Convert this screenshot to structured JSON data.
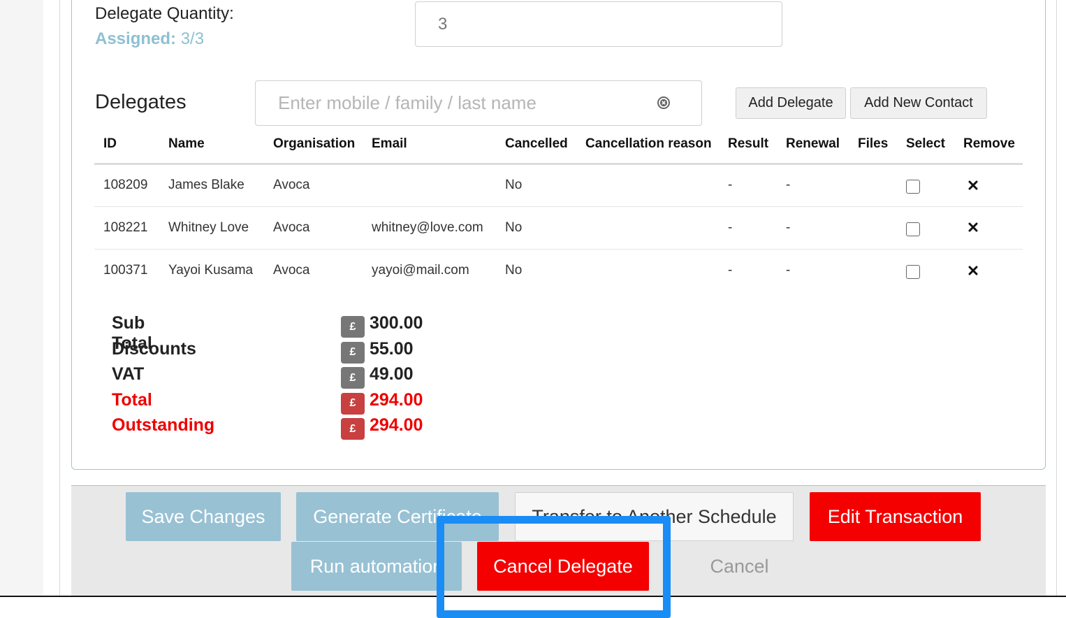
{
  "quantity": {
    "label": "Delegate Quantity:",
    "assigned_label": "Assigned:",
    "assigned_value": "3/3",
    "value": "3"
  },
  "delegates": {
    "title": "Delegates",
    "search_placeholder": "Enter mobile / family / last name",
    "add_delegate_label": "Add Delegate",
    "add_contact_label": "Add New Contact",
    "columns": [
      "ID",
      "Name",
      "Organisation",
      "Email",
      "Cancelled",
      "Cancellation reason",
      "Result",
      "Renewal",
      "Files",
      "Select",
      "Remove"
    ],
    "rows": [
      {
        "id": "108209",
        "name": "James Blake",
        "org": "Avoca",
        "email": "",
        "cancelled": "No",
        "reason": "",
        "result": "-",
        "renewal": "-",
        "files": ""
      },
      {
        "id": "108221",
        "name": "Whitney Love",
        "org": "Avoca",
        "email": "whitney@love.com",
        "cancelled": "No",
        "reason": "",
        "result": "-",
        "renewal": "-",
        "files": ""
      },
      {
        "id": "100371",
        "name": "Yayoi Kusama",
        "org": "Avoca",
        "email": "yayoi@mail.com",
        "cancelled": "No",
        "reason": "",
        "result": "-",
        "renewal": "-",
        "files": ""
      }
    ]
  },
  "totals": {
    "currency": "£",
    "sub_total_label": "Sub Total",
    "sub_total": "300.00",
    "discounts_label": "Discounts",
    "discounts": "55.00",
    "vat_label": "VAT",
    "vat": "49.00",
    "total_label": "Total",
    "total": "294.00",
    "outstanding_label": "Outstanding",
    "outstanding": "294.00"
  },
  "footer": {
    "save_label": "Save Changes",
    "generate_label": "Generate Certificate",
    "transfer_label": "Transfer to Another Schedule",
    "edit_label": "Edit Transaction",
    "run_label": "Run automation",
    "cancel_delegate_label": "Cancel Delegate",
    "cancel_label": "Cancel"
  },
  "colors": {
    "accent_blue": "#98c1d3",
    "danger_red": "#f40000",
    "highlight": "#1a8cf5"
  },
  "icons": {
    "search_clear": "clear-circle-icon",
    "remove": "close-x-icon"
  }
}
